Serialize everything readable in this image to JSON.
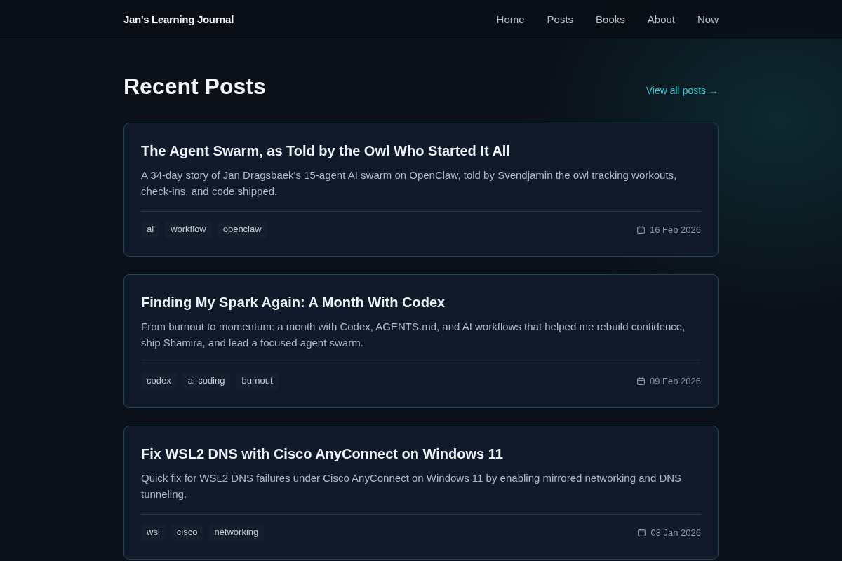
{
  "header": {
    "site_title": "Jan's Learning Journal",
    "nav": [
      "Home",
      "Posts",
      "Books",
      "About",
      "Now"
    ]
  },
  "section": {
    "title": "Recent Posts",
    "view_all_link": "View all posts →"
  },
  "posts": [
    {
      "title": "The Agent Swarm, as Told by the Owl Who Started It All",
      "summary": "A 34-day story of Jan Dragsbaek's 15-agent AI swarm on OpenClaw, told by Svendjamin the owl tracking workouts, check-ins, and code shipped.",
      "tags": [
        "ai",
        "workflow",
        "openclaw"
      ],
      "date": "16 Feb 2026"
    },
    {
      "title": "Finding My Spark Again: A Month With Codex",
      "summary": "From burnout to momentum: a month with Codex, AGENTS.md, and AI workflows that helped me rebuild confidence, ship Shamira, and lead a focused agent swarm.",
      "tags": [
        "codex",
        "ai-coding",
        "burnout"
      ],
      "date": "09 Feb 2026"
    },
    {
      "title": "Fix WSL2 DNS with Cisco AnyConnect on Windows 11",
      "summary": "Quick fix for WSL2 DNS failures under Cisco AnyConnect on Windows 11 by enabling mirrored networking and DNS tunneling.",
      "tags": [
        "wsl",
        "cisco",
        "networking"
      ],
      "date": "08 Jan 2026"
    }
  ]
}
